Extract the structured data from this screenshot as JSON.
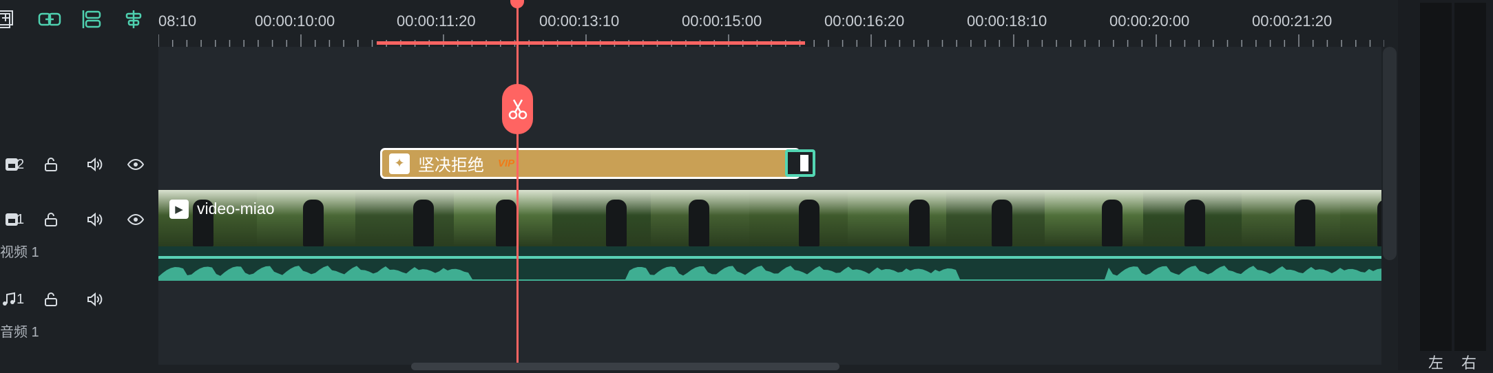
{
  "toolbar": {
    "icons": [
      "add-track-icon",
      "link-icon",
      "split-track-icon",
      "align-center-icon"
    ]
  },
  "ruler": {
    "labels": [
      "08:10",
      "00:00:10:00",
      "00:00:11:20",
      "00:00:13:10",
      "00:00:15:00",
      "00:00:16:20",
      "00:00:18:10",
      "00:00:20:00",
      "00:00:21:20"
    ]
  },
  "tracks": {
    "title_track": {
      "number": "2"
    },
    "video_track": {
      "number": "1",
      "label": "视频 1"
    },
    "audio_track": {
      "number": "1",
      "label": "音频 1"
    }
  },
  "title_clip": {
    "text": "坚决拒绝",
    "badge": "VIP"
  },
  "video_clip": {
    "name": "video-miao"
  },
  "meters": {
    "left": "左",
    "right": "右"
  },
  "colors": {
    "accent": "#4fd1b0",
    "playhead": "#ff6462",
    "title_clip": "#c9a055"
  }
}
